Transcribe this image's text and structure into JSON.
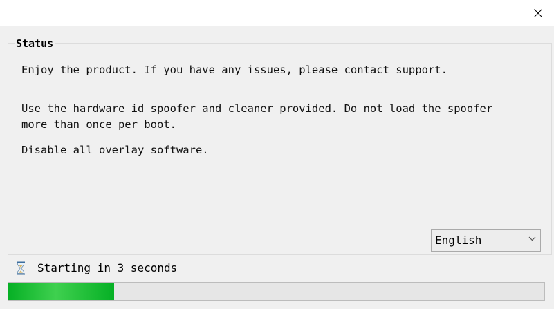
{
  "window": {
    "close_icon": "close-icon"
  },
  "status_group": {
    "title": "Status",
    "messages": [
      "Enjoy the product. If you have any issues, please contact support.",
      "Use the hardware id spoofer and cleaner provided. Do not load the spoofer",
      "more than once per boot.",
      "Disable all overlay software."
    ]
  },
  "language": {
    "selected": "English"
  },
  "status_bar": {
    "icon": "hourglass-icon",
    "text": "Starting in 3 seconds"
  },
  "progress": {
    "fraction": 0.197,
    "fill_color": "#06b025",
    "track_color": "#e6e6e6"
  }
}
